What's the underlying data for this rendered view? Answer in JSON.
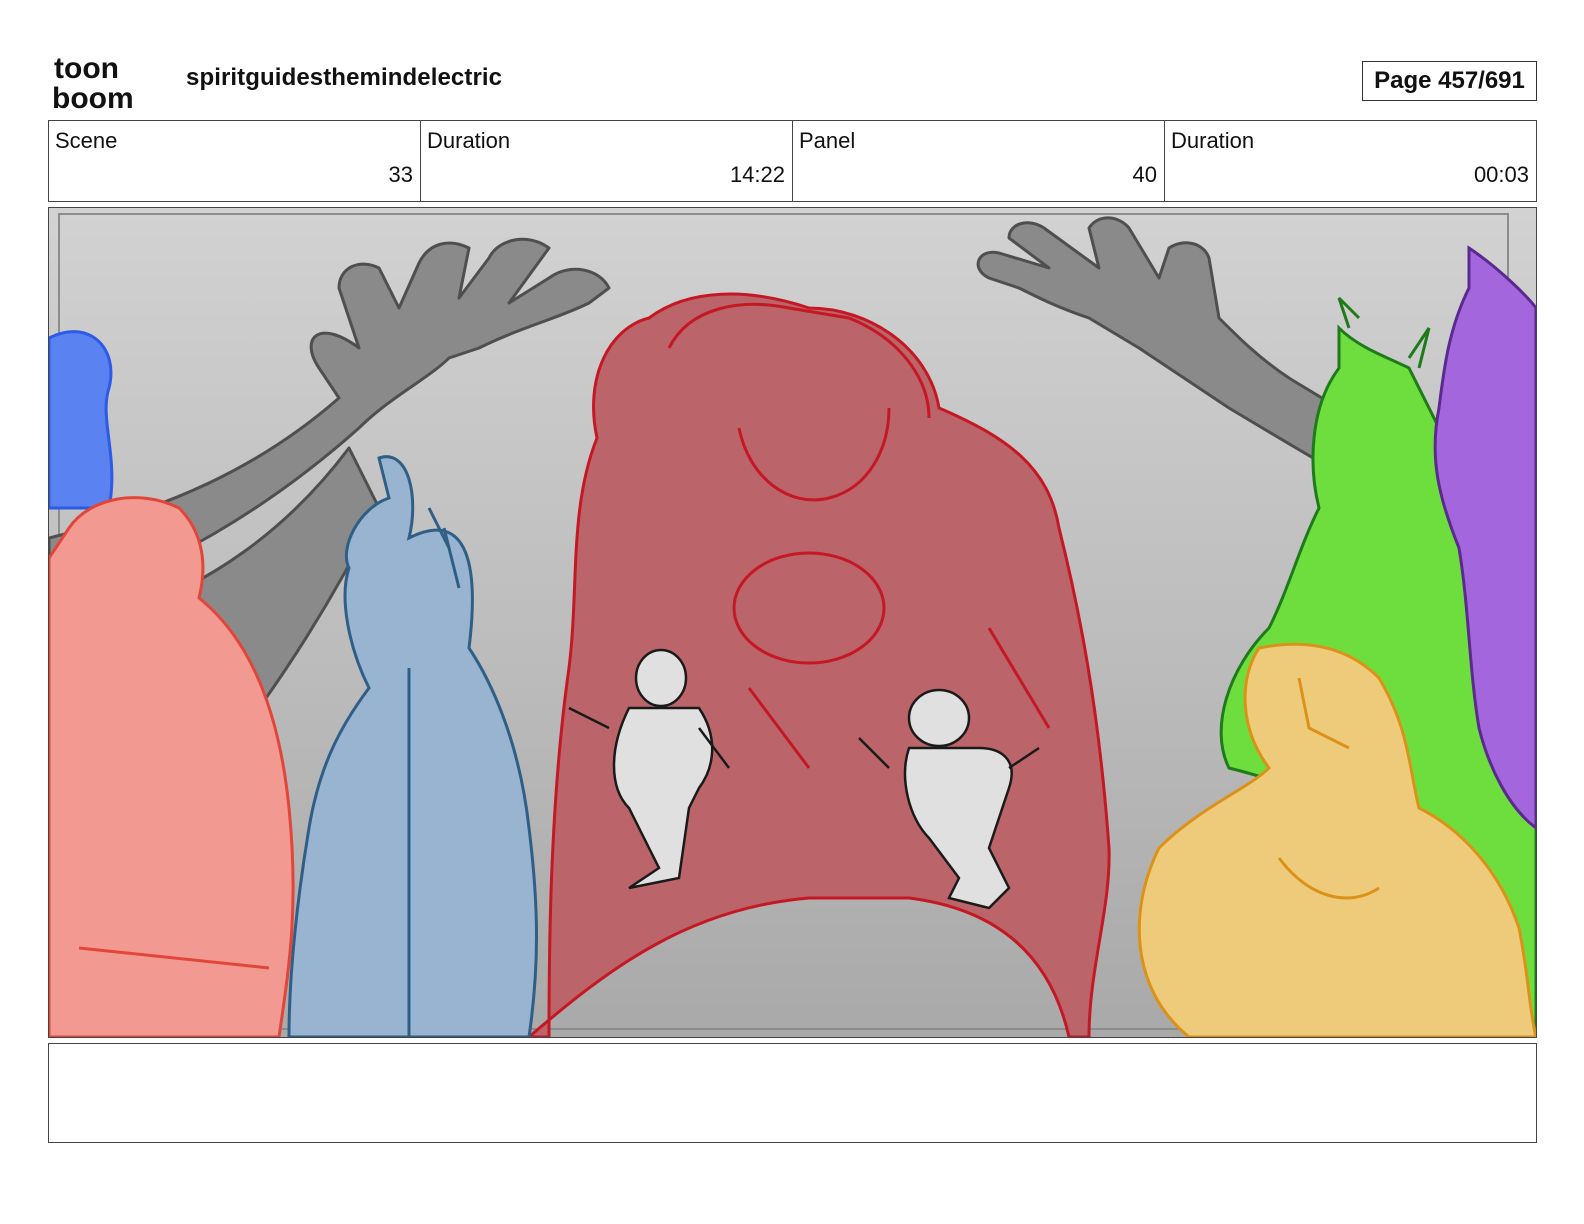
{
  "header": {
    "logo_lines": [
      "toon",
      "boom"
    ],
    "project_title": "spiritguidesthemindelectric",
    "page_label": "Page 457/691"
  },
  "info": {
    "scene_label": "Scene",
    "scene_value": "33",
    "scene_duration_label": "Duration",
    "scene_duration_value": "14:22",
    "panel_label": "Panel",
    "panel_value": "40",
    "panel_duration_label": "Duration",
    "panel_duration_value": "00:03"
  },
  "panel": {
    "colors": {
      "background_top": "#d2d2d2",
      "background_bottom": "#a9a9a9",
      "center_figure": "#bb646a",
      "center_line": "#c41824",
      "arms": "#8a8a8a",
      "blue_figure": "#98b4d0",
      "pink_figure": "#f29a92",
      "blue_hair": "#5a82f0",
      "green_figure": "#6ede3e",
      "purple_figure": "#a466dc",
      "yellow_figure": "#eecb7a",
      "small_figures": "#e0e0e0"
    }
  },
  "notes": {
    "text": ""
  }
}
